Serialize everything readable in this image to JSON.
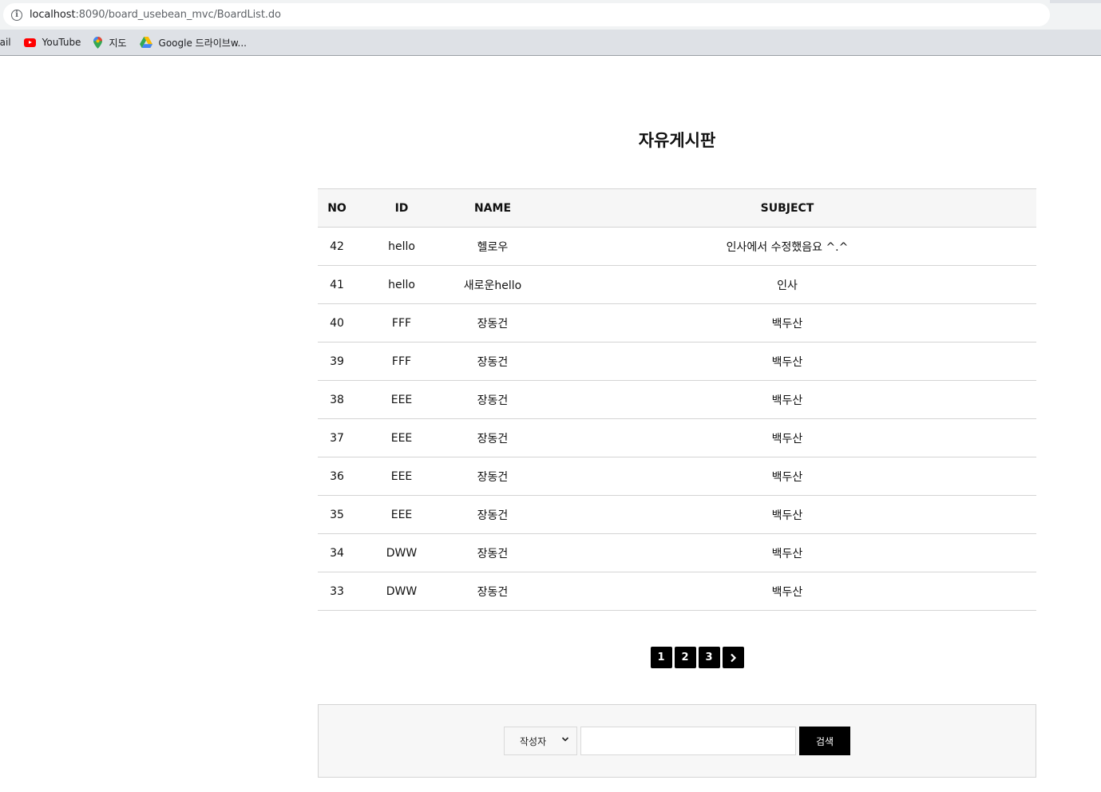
{
  "browser": {
    "url_host": "localhost",
    "url_path": ":8090/board_usebean_mvc/BoardList.do"
  },
  "bookmarks": {
    "gmail": "nail",
    "youtube": "YouTube",
    "maps": "지도",
    "drive": "Google 드라이브w..."
  },
  "page": {
    "title": "자유게시판"
  },
  "table": {
    "headers": {
      "no": "NO",
      "id": "ID",
      "name": "NAME",
      "subject": "SUBJECT"
    },
    "rows": [
      {
        "no": "42",
        "id": "hello",
        "name": "헬로우",
        "subject": "인사에서 수정했음요 ^.^"
      },
      {
        "no": "41",
        "id": "hello",
        "name": "새로운hello",
        "subject": "인사"
      },
      {
        "no": "40",
        "id": "FFF",
        "name": "장동건",
        "subject": "백두산"
      },
      {
        "no": "39",
        "id": "FFF",
        "name": "장동건",
        "subject": "백두산"
      },
      {
        "no": "38",
        "id": "EEE",
        "name": "장동건",
        "subject": "백두산"
      },
      {
        "no": "37",
        "id": "EEE",
        "name": "장동건",
        "subject": "백두산"
      },
      {
        "no": "36",
        "id": "EEE",
        "name": "장동건",
        "subject": "백두산"
      },
      {
        "no": "35",
        "id": "EEE",
        "name": "장동건",
        "subject": "백두산"
      },
      {
        "no": "34",
        "id": "DWW",
        "name": "장동건",
        "subject": "백두산"
      },
      {
        "no": "33",
        "id": "DWW",
        "name": "장동건",
        "subject": "백두산"
      }
    ]
  },
  "pagination": {
    "pages": [
      "1",
      "2",
      "3"
    ],
    "next_icon": "chevron-right-icon"
  },
  "search": {
    "field_selected": "작성자",
    "keyword_value": "",
    "button_label": "검색"
  }
}
